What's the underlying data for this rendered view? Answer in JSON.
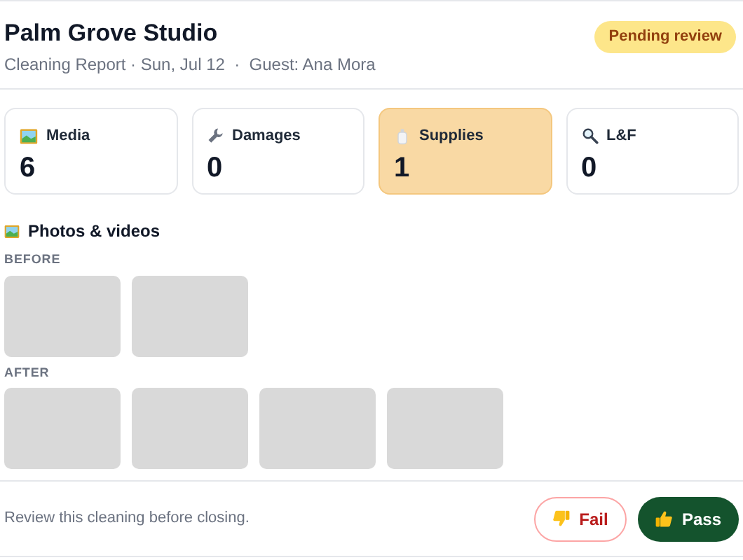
{
  "header": {
    "title": "Palm Grove Studio",
    "subtitle": "Cleaning Report · Sun, Jul 12  ·  Guest: Ana Mora",
    "status": "Pending review"
  },
  "stats": [
    {
      "kind": "media",
      "label": "Media",
      "value": "6",
      "selected": false
    },
    {
      "kind": "damages",
      "label": "Damages",
      "value": "0",
      "selected": false
    },
    {
      "kind": "supplies",
      "label": "Supplies",
      "value": "1",
      "selected": true
    },
    {
      "kind": "lost",
      "label": "L&F",
      "value": "0",
      "selected": false
    }
  ],
  "media": {
    "title": "Photos & videos",
    "groups": [
      {
        "label": "BEFORE",
        "tiles": [
          {
            "kind": "placeholder"
          },
          {
            "kind": "placeholder"
          }
        ]
      },
      {
        "label": "AFTER",
        "tiles": [
          {
            "kind": "placeholder"
          },
          {
            "kind": "placeholder"
          },
          {
            "kind": "placeholder"
          },
          {
            "kind": "placeholder"
          }
        ]
      }
    ]
  },
  "footer": {
    "note": "Review this cleaning before closing.",
    "buttons": [
      {
        "kind": "fail",
        "label": "Fail"
      },
      {
        "kind": "pass",
        "label": "Pass"
      }
    ]
  }
}
